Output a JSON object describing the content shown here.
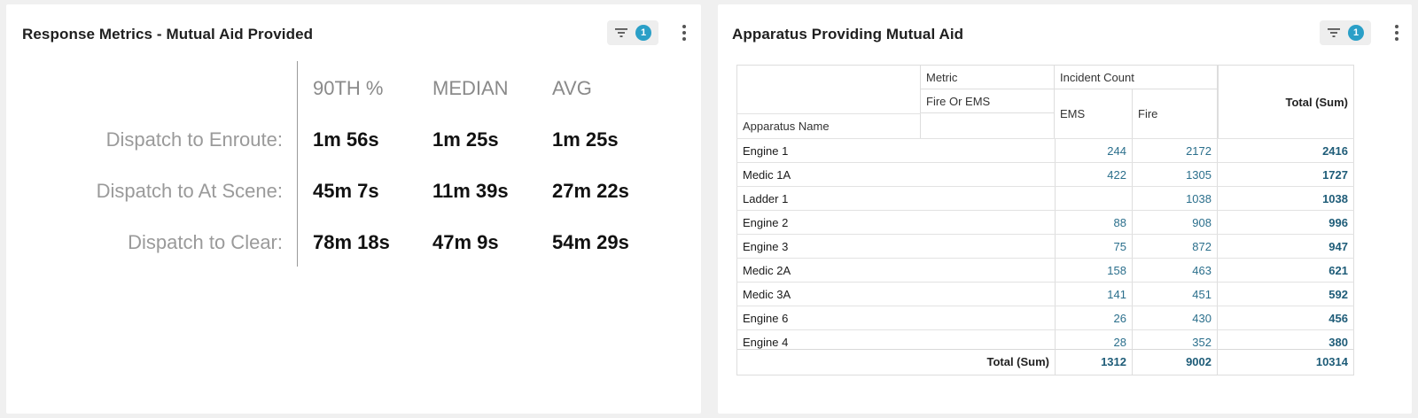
{
  "metrics_card": {
    "title": "Response Metrics - Mutual Aid Provided",
    "filter_count": "1",
    "headers": [
      "90TH %",
      "MEDIAN",
      "AVG"
    ],
    "rows": [
      {
        "label": "Dispatch to Enroute:",
        "p90": "1m 56s",
        "median": "1m 25s",
        "avg": "1m 25s"
      },
      {
        "label": "Dispatch to At Scene:",
        "p90": "45m 7s",
        "median": "11m 39s",
        "avg": "27m 22s"
      },
      {
        "label": "Dispatch to Clear:",
        "p90": "78m 18s",
        "median": "47m 9s",
        "avg": "54m 29s"
      }
    ]
  },
  "apparatus_card": {
    "title": "Apparatus Providing Mutual Aid",
    "filter_count": "1",
    "table": {
      "header_metric": "Metric",
      "header_incident_count": "Incident Count",
      "header_fire_or_ems": "Fire Or EMS",
      "header_ems": "EMS",
      "header_fire": "Fire",
      "header_apparatus_name": "Apparatus Name",
      "header_total": "Total (Sum)",
      "rows": [
        {
          "name": "Engine 1",
          "ems": "244",
          "fire": "2172",
          "total": "2416"
        },
        {
          "name": "Medic 1A",
          "ems": "422",
          "fire": "1305",
          "total": "1727"
        },
        {
          "name": "Ladder 1",
          "ems": "",
          "fire": "1038",
          "total": "1038"
        },
        {
          "name": "Engine 2",
          "ems": "88",
          "fire": "908",
          "total": "996"
        },
        {
          "name": "Engine 3",
          "ems": "75",
          "fire": "872",
          "total": "947"
        },
        {
          "name": "Medic 2A",
          "ems": "158",
          "fire": "463",
          "total": "621"
        },
        {
          "name": "Medic 3A",
          "ems": "141",
          "fire": "451",
          "total": "592"
        },
        {
          "name": "Engine 6",
          "ems": "26",
          "fire": "430",
          "total": "456"
        },
        {
          "name": "Engine 4",
          "ems": "28",
          "fire": "352",
          "total": "380"
        }
      ],
      "footer_label": "Total (Sum)",
      "footer_ems": "1312",
      "footer_fire": "9002",
      "footer_total": "10314"
    }
  },
  "icons": {
    "filter": "filter-icon",
    "more": "more-vertical-icon"
  },
  "colors": {
    "badge": "#2a9fc7",
    "number_text": "#2b6f8c",
    "metric_label": "#9a9a9a",
    "background": "#f0f0f0"
  }
}
